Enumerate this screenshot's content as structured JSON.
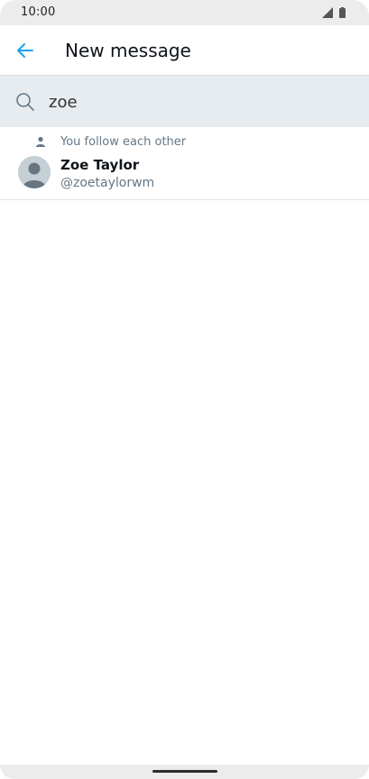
{
  "status_bar": {
    "time": "10:00",
    "icons": [
      "signal-icon",
      "battery-icon"
    ]
  },
  "app_bar": {
    "title": "New message",
    "back_icon": "arrow-left-icon",
    "accent_color": "#1da1f2"
  },
  "search": {
    "icon": "search-icon",
    "value": "zoe",
    "background": "#e6ecf0"
  },
  "results": [
    {
      "context_icon": "person-icon",
      "context": "You follow each other",
      "display_name": "Zoe Taylor",
      "handle": "@zoetaylorwm",
      "avatar_icon": "default-avatar-icon"
    }
  ]
}
